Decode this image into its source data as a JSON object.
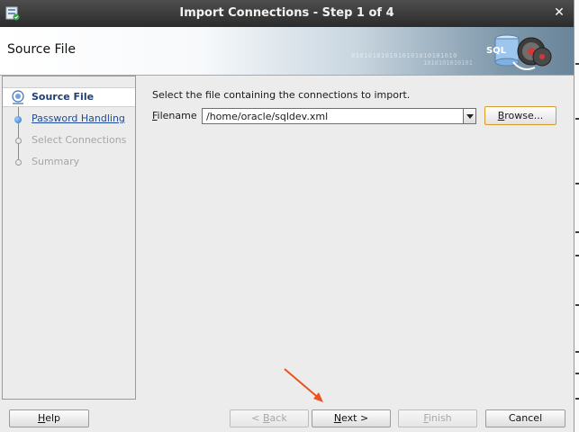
{
  "window": {
    "title": "Import Connections - Step 1 of 4",
    "close_glyph": "✕"
  },
  "header": {
    "title": "Source File",
    "graphic_label": "SQL",
    "binary_text": "0101010101010101010101010",
    "binary_text2": "1010101010101"
  },
  "nav": {
    "items": [
      {
        "label": "Source File",
        "state": "current"
      },
      {
        "label": "Password Handling",
        "state": "link"
      },
      {
        "label": "Select Connections",
        "state": "disabled"
      },
      {
        "label": "Summary",
        "state": "disabled"
      }
    ]
  },
  "content": {
    "instruction": "Select the file containing the connections to import.",
    "filename_label": "Filename",
    "filename_value": "/home/oracle/sqldev.xml",
    "browse_label": "Browse..."
  },
  "buttons": {
    "help": {
      "label": "Help",
      "mnemonic": "H",
      "rest": "elp"
    },
    "back": {
      "label": "< Back",
      "pre": "< ",
      "mnemonic": "B",
      "rest": "ack"
    },
    "next": {
      "label": "Next >",
      "mnemonic": "N",
      "rest": "ext >"
    },
    "finish": {
      "label": "Finish",
      "mnemonic": "F",
      "rest": "inish"
    },
    "cancel": {
      "label": "Cancel"
    }
  },
  "colors": {
    "annotation_arrow": "#e8531f",
    "browse_focus": "#d79b2b",
    "link": "#1f4a9a"
  },
  "icons": [
    "app-icon",
    "close-icon",
    "sql-database-icon",
    "current-step-icon",
    "dropdown-arrow-icon"
  ]
}
